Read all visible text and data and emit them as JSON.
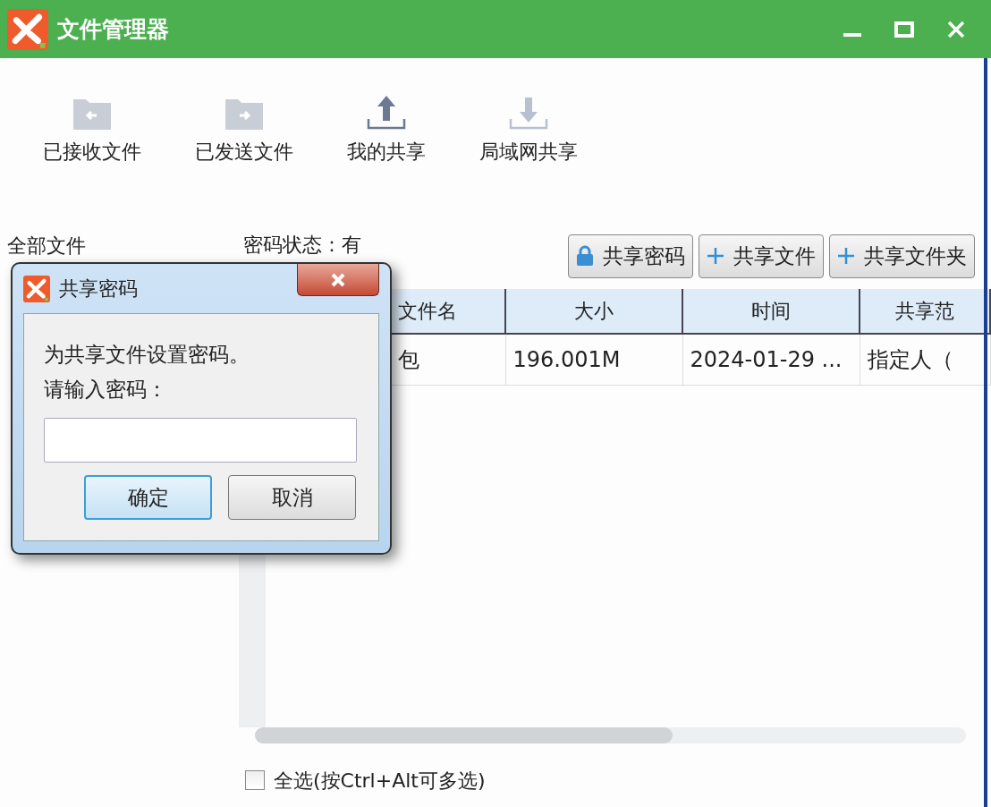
{
  "window": {
    "title": "文件管理器"
  },
  "toolbar": [
    {
      "label": "已接收文件",
      "kind": "received"
    },
    {
      "label": "已发送文件",
      "kind": "sent"
    },
    {
      "label": "我的共享",
      "kind": "upload"
    },
    {
      "label": "局域网共享",
      "kind": "download"
    }
  ],
  "sidebar": {
    "heading": "全部文件"
  },
  "password_status": "密码状态：有",
  "actions": [
    {
      "label": "共享密码",
      "kind": "lock"
    },
    {
      "label": "共享文件",
      "kind": "add"
    },
    {
      "label": "共享文件夹",
      "kind": "add"
    }
  ],
  "table": {
    "columns": [
      "文件名",
      "大小",
      "时间",
      "共享范"
    ],
    "rows": [
      [
        "包",
        "196.001M",
        "2024-01-29 ...",
        "指定人（"
      ]
    ]
  },
  "select_all": {
    "label": "全选(按Ctrl+Alt可多选)",
    "checked": false
  },
  "dialog": {
    "title": "共享密码",
    "message": "为共享文件设置密码。",
    "prompt": "请输入密码：",
    "buttons": [
      {
        "label": "确定",
        "focused": true
      },
      {
        "label": "取消",
        "focused": false
      }
    ]
  }
}
